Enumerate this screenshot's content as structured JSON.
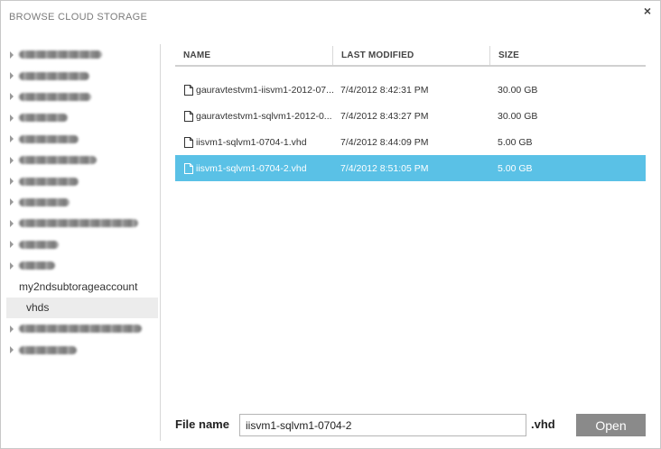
{
  "dialog": {
    "title": "BROWSE CLOUD STORAGE",
    "close_glyph": "×"
  },
  "sidebar": {
    "items": [
      {
        "label": "",
        "redacted": true,
        "blur_width": 92,
        "expandable": true
      },
      {
        "label": "",
        "redacted": true,
        "blur_width": 78,
        "expandable": true
      },
      {
        "label": "",
        "redacted": true,
        "blur_width": 80,
        "expandable": true
      },
      {
        "label": "",
        "redacted": true,
        "blur_width": 54,
        "expandable": true
      },
      {
        "label": "",
        "redacted": true,
        "blur_width": 66,
        "expandable": true
      },
      {
        "label": "",
        "redacted": true,
        "blur_width": 86,
        "expandable": true
      },
      {
        "label": "",
        "redacted": true,
        "blur_width": 66,
        "expandable": true
      },
      {
        "label": "",
        "redacted": true,
        "blur_width": 56,
        "expandable": true
      },
      {
        "label": "",
        "redacted": true,
        "blur_width": 132,
        "expandable": true
      },
      {
        "label": "",
        "redacted": true,
        "blur_width": 44,
        "expandable": true
      },
      {
        "label": "",
        "redacted": true,
        "blur_width": 40,
        "expandable": true
      },
      {
        "label": "my2ndsubtorageaccount",
        "redacted": false,
        "expandable": false
      },
      {
        "label": "vhds",
        "redacted": false,
        "expandable": false,
        "selected": true
      },
      {
        "label": "",
        "redacted": true,
        "blur_width": 136,
        "expandable": true
      },
      {
        "label": "",
        "redacted": true,
        "blur_width": 64,
        "expandable": true
      }
    ]
  },
  "table": {
    "headers": {
      "name": "NAME",
      "modified": "LAST MODIFIED",
      "size": "SIZE"
    },
    "rows": [
      {
        "name": "gauravtestvm1-iisvm1-2012-07...",
        "modified": "7/4/2012 8:42:31 PM",
        "size": "30.00 GB"
      },
      {
        "name": "gauravtestvm1-sqlvm1-2012-0...",
        "modified": "7/4/2012 8:43:27 PM",
        "size": "30.00 GB"
      },
      {
        "name": "iisvm1-sqlvm1-0704-1.vhd",
        "modified": "7/4/2012 8:44:09 PM",
        "size": "5.00 GB"
      },
      {
        "name": "iisvm1-sqlvm1-0704-2.vhd",
        "modified": "7/4/2012 8:51:05 PM",
        "size": "5.00 GB",
        "selected": true
      }
    ],
    "file_icon": "document-icon"
  },
  "footer": {
    "file_name_label": "File name",
    "file_name_value": "iisvm1-sqlvm1-0704-2",
    "extension": ".vhd",
    "open_label": "Open"
  },
  "colors": {
    "selection": "#5ac1e6",
    "open_button": "#8a8a8a"
  }
}
